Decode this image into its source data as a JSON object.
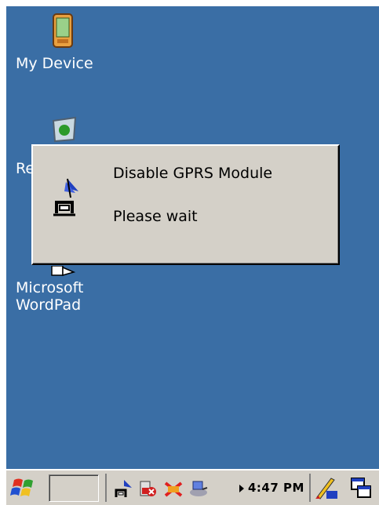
{
  "desktop": {
    "icons": [
      {
        "label": "My Device",
        "icon": "pda-device-icon"
      },
      {
        "label": "Re",
        "icon": "recycle-bin-icon"
      },
      {
        "label": "Microsoft\nWordPad",
        "icon": "wordpad-icon"
      }
    ],
    "background": "#3a6ea5"
  },
  "dialog": {
    "title_line": "Disable GPRS Module",
    "status_line": "Please wait",
    "icon": "gprs-antenna-icon"
  },
  "taskbar": {
    "start_icon": "windows-start-icon",
    "tray_icons": [
      "gprs-antenna-icon",
      "battery-error-icon",
      "network-disabled-icon",
      "network-connection-icon"
    ],
    "clock": "4:47 PM",
    "input_icon": "input-panel-icon",
    "switch_icon": "window-switch-icon"
  },
  "colors": {
    "desktop": "#3a6ea5",
    "dialog_face": "#d4d0c8",
    "text": "#000000",
    "desktop_text": "#ffffff"
  }
}
